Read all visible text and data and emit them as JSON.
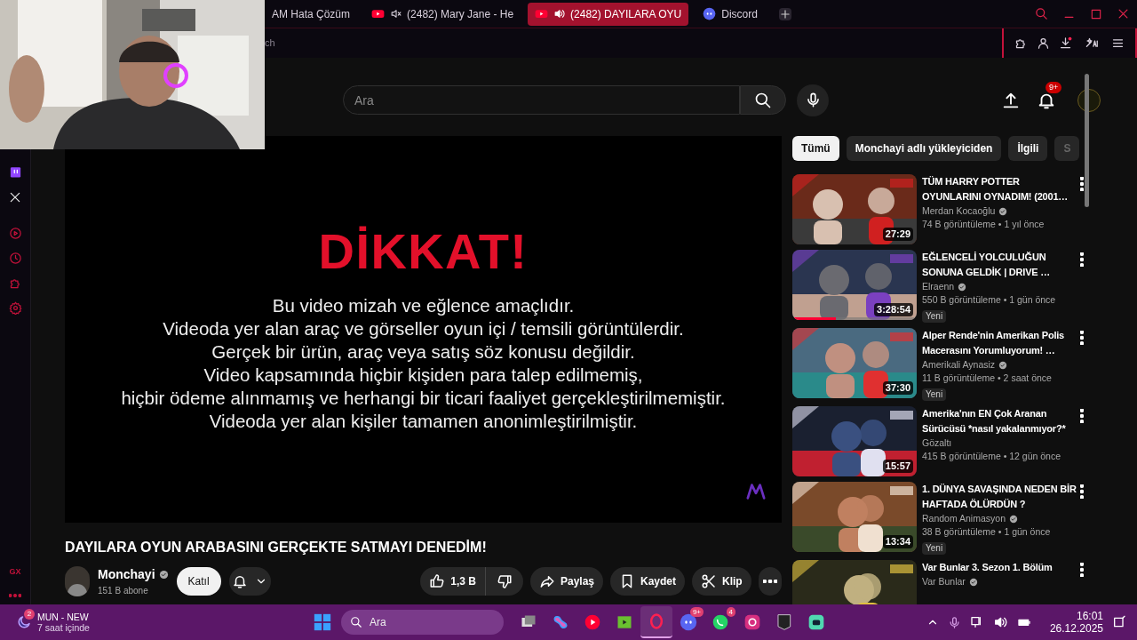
{
  "browser": {
    "tabs": [
      {
        "title": "AM Hata Çözüm",
        "selected": false,
        "muted": false,
        "sound_on": false,
        "kind": "none"
      },
      {
        "title": "(2482) Mary Jane - He",
        "selected": false,
        "muted": true,
        "sound_on": false,
        "kind": "youtube"
      },
      {
        "title": "(2482) DAYILARA OYU",
        "selected": true,
        "muted": false,
        "sound_on": true,
        "kind": "youtube"
      },
      {
        "title": "Discord",
        "selected": false,
        "muted": false,
        "sound_on": false,
        "kind": "discord"
      }
    ],
    "address": "ch",
    "sidebar_logo": "GX"
  },
  "youtube": {
    "search": {
      "placeholder": "Ara"
    },
    "notifications_badge": "9+",
    "video": {
      "heading": "DİKKAT!",
      "lines": [
        "Bu video mizah ve eğlence amaçlıdır.",
        "Videoda yer alan araç ve görseller oyun içi / temsili görüntülerdir.",
        "Gerçek bir ürün, araç veya satış söz konusu değildir.",
        "Video kapsamında hiçbir kişiden para talep edilmemiş,",
        "hiçbir ödeme alınmamış ve herhangi bir ticari faaliyet gerçekleştirilmemiştir.",
        "Videoda yer alan kişiler tamamen anonimleştirilmiştir."
      ]
    },
    "title": "DAYILARA OYUN ARABASINI GERÇEKTE SATMAYI DENEDİM!",
    "channel": {
      "name": "Monchayi",
      "verified": true,
      "subscribers": "151 B abone"
    },
    "join": "Katıl",
    "likes": "1,3 B",
    "share": "Paylaş",
    "save": "Kaydet",
    "clip": "Klip",
    "chips": [
      {
        "label": "Tümü",
        "selected": true
      },
      {
        "label": "Monchayi adlı yükleyiciden",
        "selected": false
      },
      {
        "label": "İlgili",
        "selected": false
      },
      {
        "label": "S",
        "selected": false
      }
    ],
    "recommendations": [
      {
        "title": "TÜM HARRY POTTER OYUNLARINI OYNADIM! (2001…",
        "channel": "Merdan Kocaoğlu",
        "verified": true,
        "meta": "74 B görüntüleme • 1 yıl önce",
        "duration": "27:29"
      },
      {
        "title": "EĞLENCELİ YOLCULUĞUN SONUNA GELDİK | DRIVE …",
        "channel": "Elraenn",
        "verified": true,
        "meta": "550 B görüntüleme • 1 gün önce",
        "duration": "3:28:54",
        "badge": "Yeni",
        "level": 0.35
      },
      {
        "title": "Alper Rende'nin Amerikan Polis Macerasını Yorumluyorum! …",
        "channel": "Amerikali Aynasiz",
        "verified": true,
        "meta": "11 B görüntüleme • 2 saat önce",
        "duration": "37:30",
        "badge": "Yeni"
      },
      {
        "title": "Amerika'nın EN Çok Aranan Sürücüsü *nasıl yakalanmıyor?*",
        "channel": "Gözaltı",
        "verified": false,
        "meta": "415 B görüntüleme • 12 gün önce",
        "duration": "15:57"
      },
      {
        "title": "1. DÜNYA SAVAŞINDA NEDEN BİR HAFTADA ÖLÜRDÜN ?",
        "channel": "Random Animasyon",
        "verified": true,
        "meta": "38 B görüntüleme • 1 gün önce",
        "duration": "13:34",
        "badge": "Yeni"
      },
      {
        "title": "Var Bunlar 3. Sezon 1. Bölüm",
        "channel": "Var Bunlar",
        "verified": true
      }
    ]
  },
  "taskbar": {
    "weather": {
      "title": "MUN - NEW",
      "subtitle": "7 saat içinde",
      "badge": "2"
    },
    "search": {
      "placeholder": "Ara"
    },
    "apps": [
      {
        "kind": "files"
      },
      {
        "kind": "copilot"
      },
      {
        "kind": "music"
      },
      {
        "kind": "video"
      },
      {
        "kind": "opera",
        "selected": true
      },
      {
        "kind": "discord",
        "badge": "9+"
      },
      {
        "kind": "whatsapp",
        "badge": "4"
      },
      {
        "kind": "instagram"
      },
      {
        "kind": "epic"
      },
      {
        "kind": "chat"
      }
    ],
    "time": "16:01",
    "date": "26.12.2025"
  }
}
